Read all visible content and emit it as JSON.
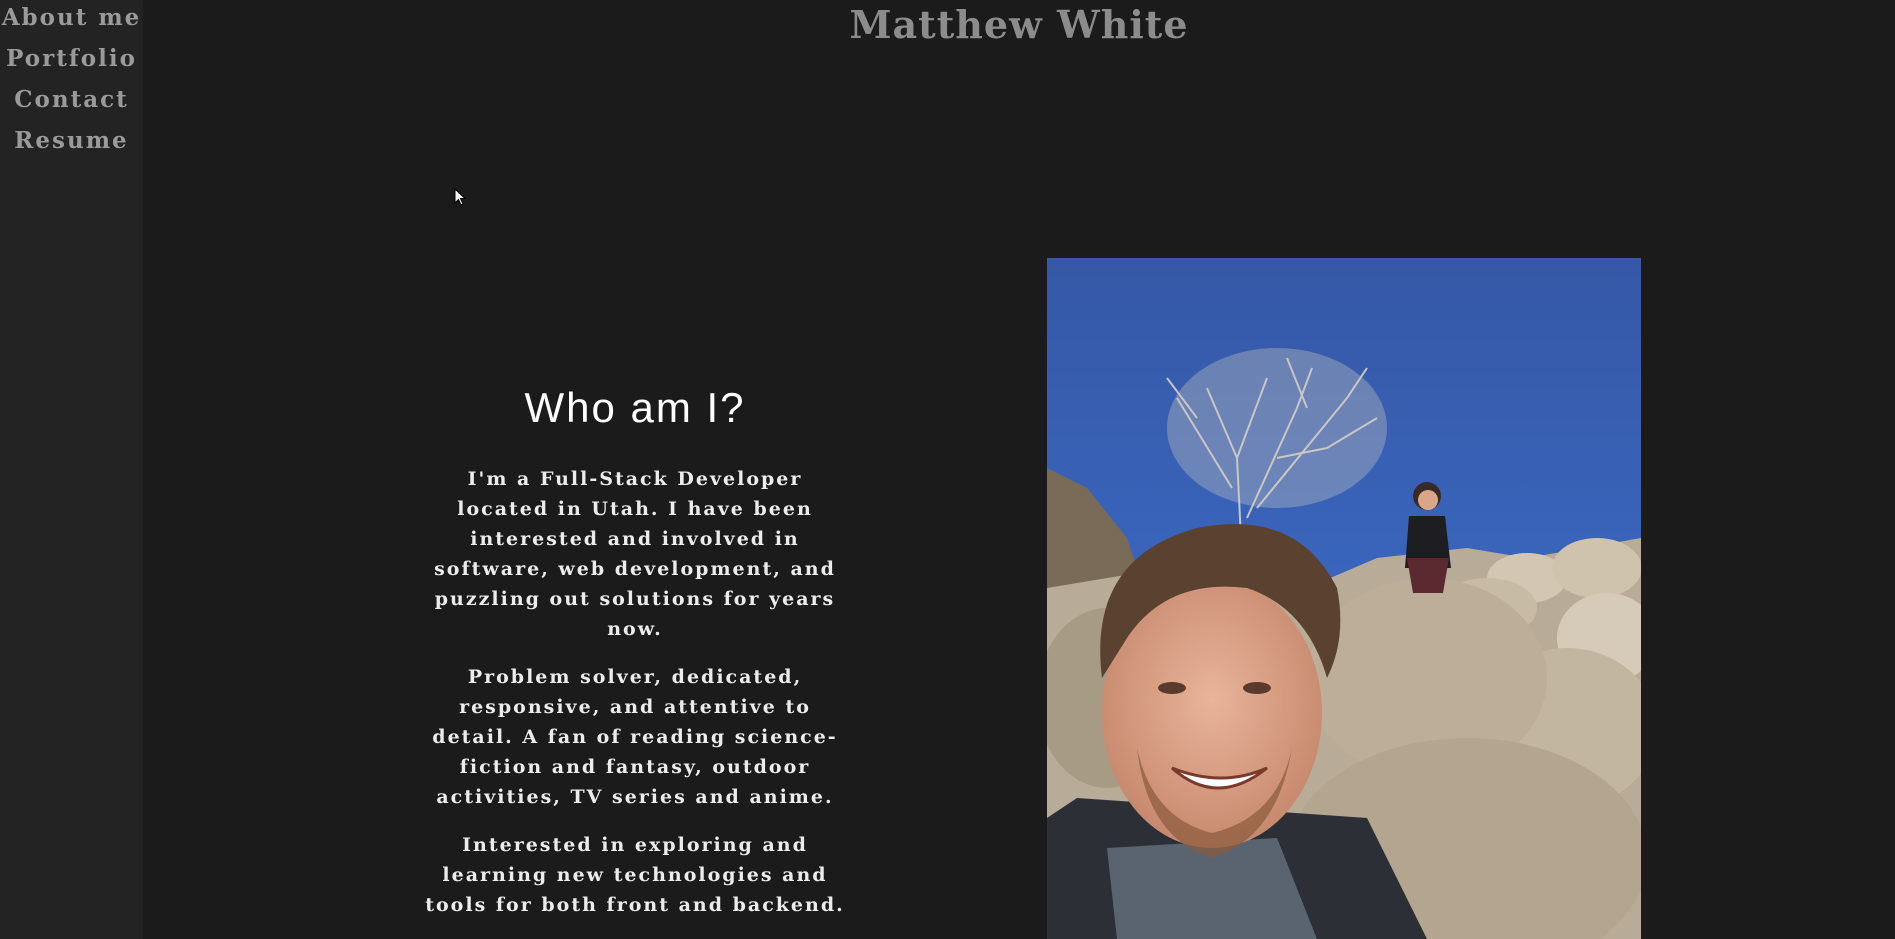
{
  "nav": {
    "items": [
      {
        "label": "About me"
      },
      {
        "label": "Portfolio"
      },
      {
        "label": "Contact"
      },
      {
        "label": "Resume"
      }
    ]
  },
  "header": {
    "title": "Matthew White"
  },
  "about": {
    "heading": "Who am I?",
    "paragraphs": [
      "I'm a Full-Stack Developer located in Utah. I have been interested and involved in software, web development, and puzzling out solutions for years now.",
      "Problem solver, dedicated, responsive, and attentive to detail. A fan of reading science-fiction and fantasy, outdoor activities, TV series and anime.",
      "Interested in exploring and learning new technologies and tools for both front and backend."
    ]
  },
  "photo": {
    "icon": "profile-photo"
  },
  "colors": {
    "background": "#1b1b1b",
    "sidebar": "#232323",
    "nav_text": "#9a9a9a",
    "title_text": "#8c8c8c",
    "body_text": "#ececec"
  }
}
